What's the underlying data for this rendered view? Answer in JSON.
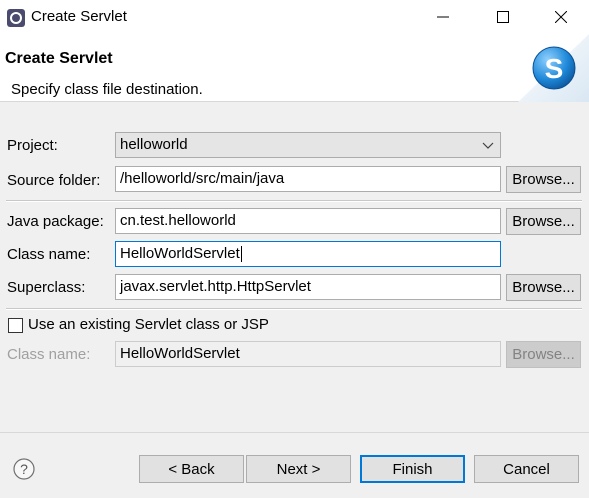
{
  "window": {
    "title": "Create Servlet",
    "controls": [
      "minimize-icon",
      "maximize-icon",
      "close-icon"
    ]
  },
  "header": {
    "title": "Create Servlet",
    "description": "Specify class file destination.",
    "banner_letter": "S"
  },
  "form": {
    "project": {
      "label": "Project:",
      "value": "helloworld"
    },
    "source_folder": {
      "label": "Source folder:",
      "value": "/helloworld/src/main/java",
      "browse": "Browse..."
    },
    "java_package": {
      "label": "Java package:",
      "value": "cn.test.helloworld",
      "browse": "Browse..."
    },
    "class_name": {
      "label": "Class name:",
      "value": "HelloWorldServlet"
    },
    "superclass": {
      "label": "Superclass:",
      "value": "javax.servlet.http.HttpServlet",
      "browse": "Browse..."
    },
    "existing": {
      "checkbox_label": "Use an existing Servlet class or JSP",
      "checked": false,
      "class_name_label": "Class name:",
      "class_name_value": "HelloWorldServlet",
      "browse": "Browse..."
    }
  },
  "footer": {
    "help_symbol": "?",
    "back": "< Back",
    "next": "Next >",
    "finish": "Finish",
    "cancel": "Cancel"
  },
  "colors": {
    "focus_border": "#0078d7",
    "background": "#f0f0f0",
    "banner_blue": "#1e88d8"
  }
}
